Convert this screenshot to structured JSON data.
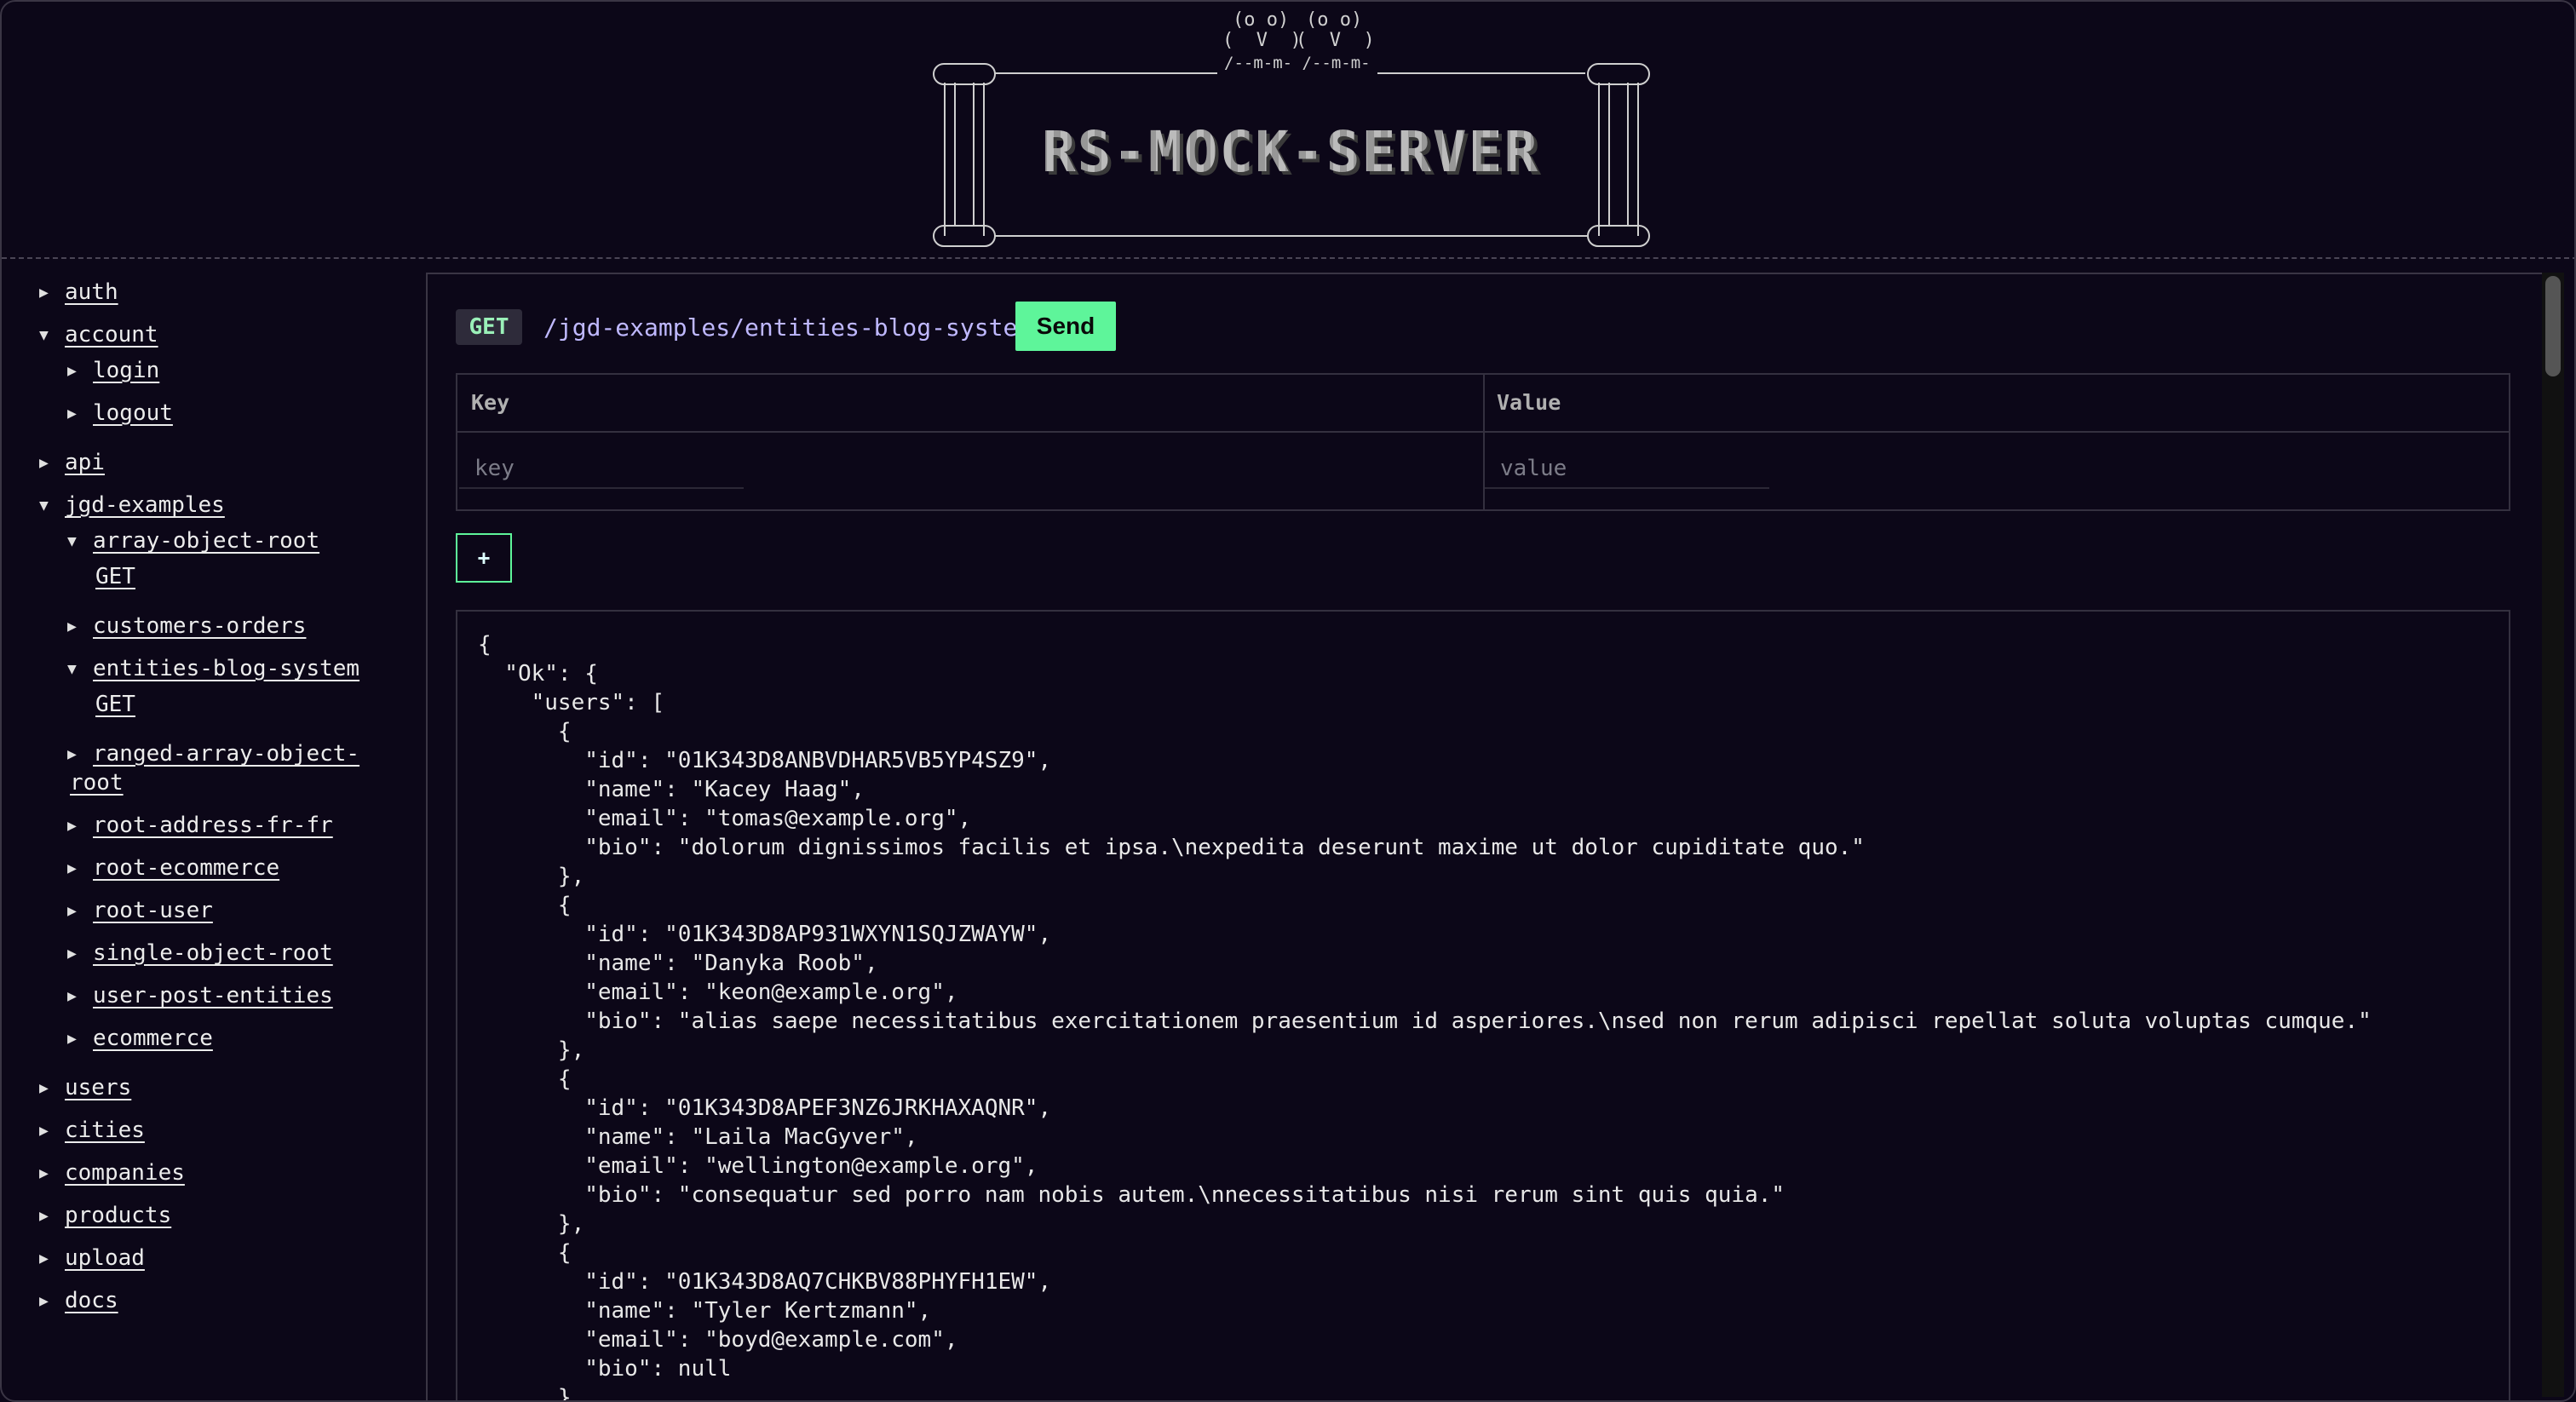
{
  "app": {
    "title": "RS-MOCK-SERVER"
  },
  "banner": {
    "eyes_left": "(o o)",
    "eyes_right": "(o o)",
    "beak_left": "(  V  )",
    "beak_right": "(  V  )",
    "feet": "/--m-m- /--m-m-"
  },
  "sidebar": {
    "items": [
      {
        "label": "auth",
        "expanded": false
      },
      {
        "label": "account",
        "expanded": true,
        "children": [
          {
            "label": "login",
            "expanded": false
          },
          {
            "label": "logout",
            "expanded": false
          }
        ]
      },
      {
        "label": "api",
        "expanded": false
      },
      {
        "label": "jgd-examples",
        "expanded": true,
        "children": [
          {
            "label": "array-object-root",
            "expanded": true,
            "method": "GET"
          },
          {
            "label": "customers-orders",
            "expanded": false
          },
          {
            "label": "entities-blog-system",
            "expanded": true,
            "method": "GET"
          },
          {
            "label": "ranged-array-object-",
            "label2": "root",
            "expanded": false
          },
          {
            "label": "root-address-fr-fr",
            "expanded": false
          },
          {
            "label": "root-ecommerce",
            "expanded": false
          },
          {
            "label": "root-user",
            "expanded": false
          },
          {
            "label": "single-object-root",
            "expanded": false
          },
          {
            "label": "user-post-entities",
            "expanded": false
          },
          {
            "label": "ecommerce",
            "expanded": false
          }
        ]
      },
      {
        "label": "users",
        "expanded": false
      },
      {
        "label": "cities",
        "expanded": false
      },
      {
        "label": "companies",
        "expanded": false
      },
      {
        "label": "products",
        "expanded": false
      },
      {
        "label": "upload",
        "expanded": false
      },
      {
        "label": "docs",
        "expanded": false
      }
    ],
    "tri_closed": "▶",
    "tri_open": "▼"
  },
  "request": {
    "method": "GET",
    "path": "/jgd-examples/entities-blog-system",
    "send_label": "Send",
    "add_label": "+",
    "params": {
      "key_header": "Key",
      "value_header": "Value",
      "key_placeholder": "key",
      "value_placeholder": "value"
    }
  },
  "response": {
    "body": "{\n  \"Ok\": {\n    \"users\": [\n      {\n        \"id\": \"01K343D8ANBVDHAR5VB5YP4SZ9\",\n        \"name\": \"Kacey Haag\",\n        \"email\": \"tomas@example.org\",\n        \"bio\": \"dolorum dignissimos facilis et ipsa.\\nexpedita deserunt maxime ut dolor cupiditate quo.\"\n      },\n      {\n        \"id\": \"01K343D8AP931WXYN1SQJZWAYW\",\n        \"name\": \"Danyka Roob\",\n        \"email\": \"keon@example.org\",\n        \"bio\": \"alias saepe necessitatibus exercitationem praesentium id asperiores.\\nsed non rerum adipisci repellat soluta voluptas cumque.\"\n      },\n      {\n        \"id\": \"01K343D8APEF3NZ6JRKHAXAQNR\",\n        \"name\": \"Laila MacGyver\",\n        \"email\": \"wellington@example.org\",\n        \"bio\": \"consequatur sed porro nam nobis autem.\\nnecessitatibus nisi rerum sint quis quia.\"\n      },\n      {\n        \"id\": \"01K343D8AQ7CHKBV88PHYFH1EW\",\n        \"name\": \"Tyler Kertzmann\",\n        \"email\": \"boyd@example.com\",\n        \"bio\": null\n      },"
  },
  "colors": {
    "background": "#0c0718",
    "accent_green": "#5ef59a",
    "path_purple": "#bfb8ff",
    "method_green": "#9af0b8"
  }
}
